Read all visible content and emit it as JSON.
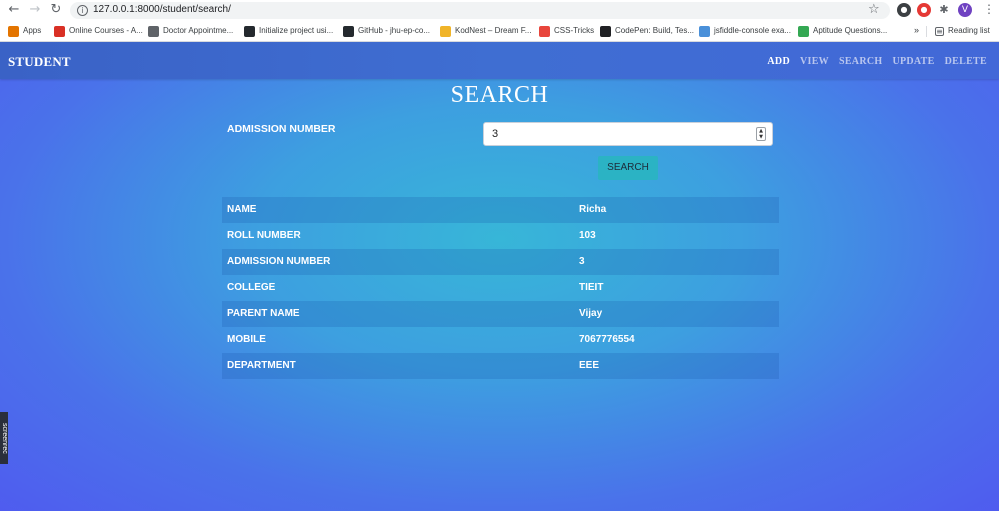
{
  "browser": {
    "url": "127.0.0.1:8000/student/search/",
    "avatar_letter": "V",
    "bookmarks": [
      {
        "label": "Apps",
        "icon": "apps-grid-icon",
        "color": "#e37400"
      },
      {
        "label": "Online Courses - A...",
        "icon": "course-icon",
        "color": "#d93025"
      },
      {
        "label": "Doctor Appointme...",
        "icon": "globe-icon",
        "color": "#5f6368"
      },
      {
        "label": "Initialize project usi...",
        "icon": "github-icon",
        "color": "#24292e"
      },
      {
        "label": "GitHub - jhu-ep-co...",
        "icon": "github-icon",
        "color": "#24292e"
      },
      {
        "label": "KodNest – Dream F...",
        "icon": "kodnest-icon",
        "color": "#f0b429"
      },
      {
        "label": "CSS-Tricks",
        "icon": "css-tricks-icon",
        "color": "#e8453c"
      },
      {
        "label": "CodePen: Build, Tes...",
        "icon": "codepen-icon",
        "color": "#202124"
      },
      {
        "label": "jsfiddle-console exa...",
        "icon": "cloud-icon",
        "color": "#4a90d9"
      },
      {
        "label": "Aptitude Questions...",
        "icon": "aptitude-icon",
        "color": "#34a853"
      }
    ],
    "more_label": "»",
    "reading_list": "Reading list"
  },
  "navbar": {
    "brand": "STUDENT",
    "links": [
      "ADD",
      "VIEW",
      "SEARCH",
      "UPDATE",
      "DELETE"
    ],
    "active_link": "ADD"
  },
  "page": {
    "title": "SEARCH",
    "form_label": "ADMISSION NUMBER",
    "input_value": "3",
    "search_button": "SEARCH"
  },
  "results": [
    {
      "key": "NAME",
      "value": "Richa"
    },
    {
      "key": "ROLL NUMBER",
      "value": "103"
    },
    {
      "key": "ADMISSION NUMBER",
      "value": "3"
    },
    {
      "key": "COLLEGE",
      "value": "TIEIT"
    },
    {
      "key": "PARENT NAME",
      "value": "Vijay"
    },
    {
      "key": "MOBILE",
      "value": "7067776554"
    },
    {
      "key": "DEPARTMENT",
      "value": "EEE"
    }
  ],
  "watermark": "screenrec"
}
